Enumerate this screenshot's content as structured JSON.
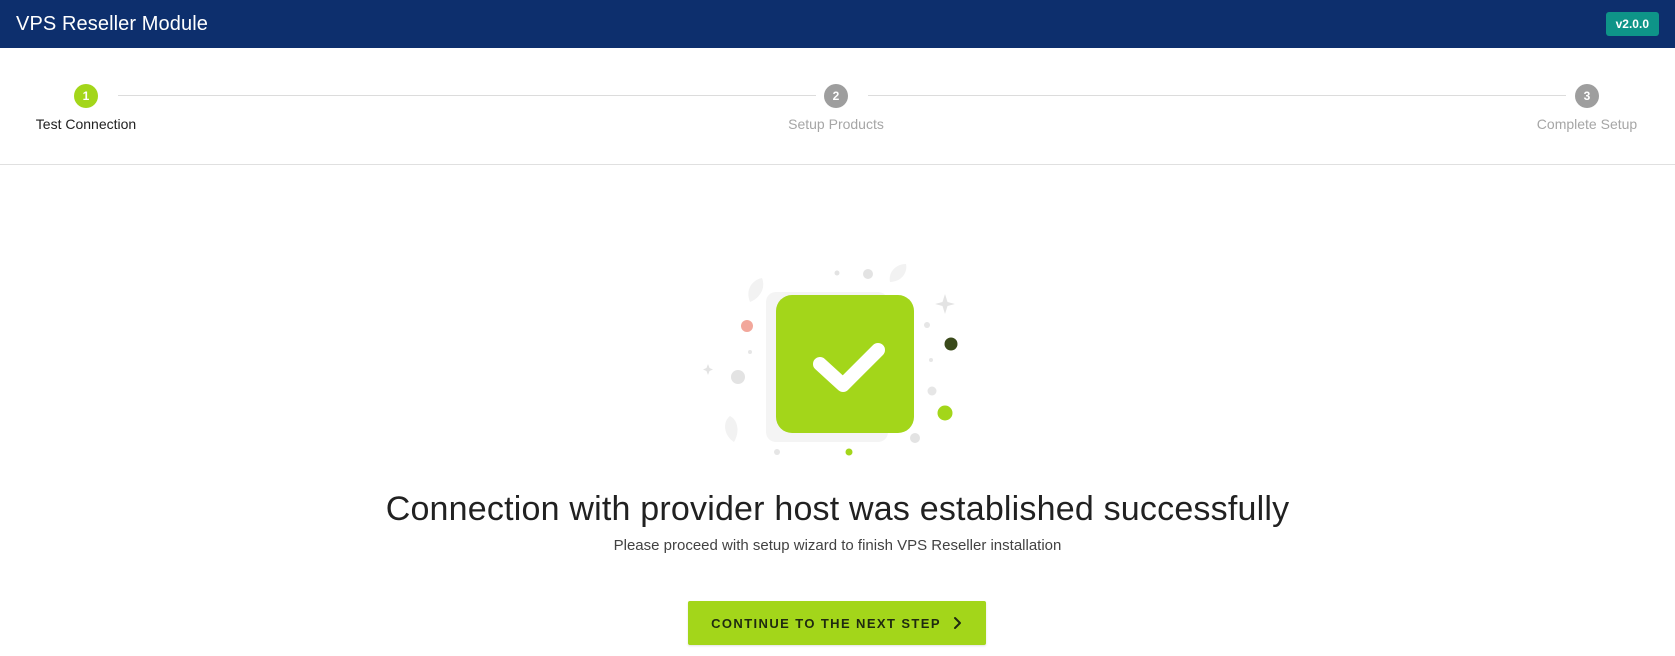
{
  "header": {
    "title": "VPS Reseller Module",
    "version": "v2.0.0"
  },
  "stepper": {
    "steps": [
      {
        "number": "1",
        "label": "Test Connection",
        "state": "active"
      },
      {
        "number": "2",
        "label": "Setup Products",
        "state": "inactive"
      },
      {
        "number": "3",
        "label": "Complete Setup",
        "state": "inactive"
      }
    ]
  },
  "main": {
    "illustration_icon": "success-checkmark-icon",
    "headline": "Connection with provider host was established successfully",
    "subtext": "Please proceed with setup wizard to finish VPS Reseller installation",
    "continue_label": "CONTINUE TO THE NEXT STEP",
    "continue_icon": "chevron-right-icon"
  },
  "colors": {
    "header_bg": "#0d2f6d",
    "badge_bg": "#0e9488",
    "accent": "#a3d61a",
    "inactive_step": "#9e9e9e"
  }
}
